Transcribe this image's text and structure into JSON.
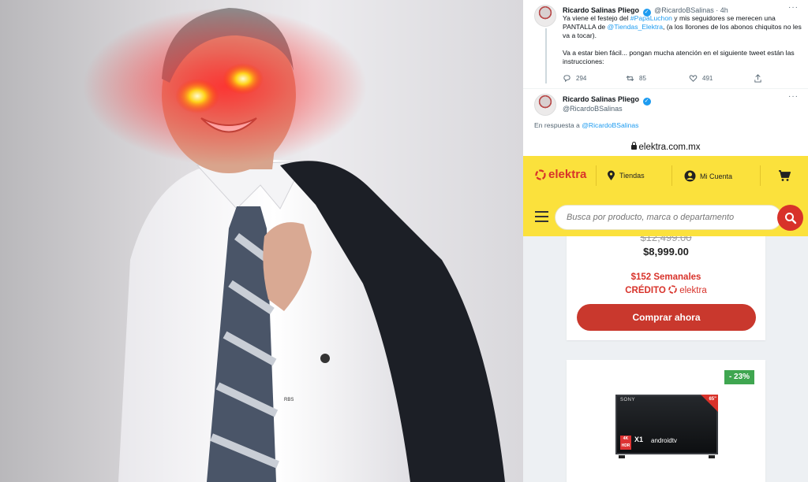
{
  "tweet1": {
    "name": "Ricardo Salinas Pliego",
    "handle": "@RicardoBSalinas",
    "time": "· 4h",
    "text_p1_a": "Ya viene el festejo del ",
    "hashtag": "#PapaLuchon",
    "text_p1_b": " y mis seguidores se merecen una PANTALLA de ",
    "mention": "@Tiendas_Elektra",
    "text_p1_c": ", (a los llorones de los abonos chiquitos no les va a tocar).",
    "text_p2": "Va a estar bien fácil... pongan mucha atención en el siguiente tweet están las instrucciones:",
    "replies": "294",
    "retweets": "85",
    "likes": "491"
  },
  "tweet2": {
    "name": "Ricardo Salinas Pliego",
    "handle": "@RicardoBSalinas",
    "reply_prefix": "En respuesta a ",
    "reply_to": "@RicardoBSalinas"
  },
  "browser": {
    "url": "elektra.com.mx"
  },
  "elektra": {
    "logo": "elektra",
    "nav_stores": "Tiendas",
    "nav_account": "Mi Cuenta",
    "search_placeholder": "Busca por producto, marca o departamento",
    "product1": {
      "old_price": "$12,499.00",
      "price": "$8,999.00",
      "weekly": "$152 Semanales",
      "credit_label": "CRÉDITO",
      "credit_brand": "elektra",
      "buy_label": "Comprar ahora"
    },
    "product2": {
      "discount": "- 23%",
      "tv_brand": "SONY",
      "tv_model": "X1",
      "tv_os": "androidtv",
      "tv_size": "65\"",
      "tv_badge": "4K HDR"
    }
  },
  "colors": {
    "elektra_yellow": "#fbe13c",
    "elektra_red": "#d8322a",
    "twitter_blue": "#1d9bf0",
    "discount_green": "#3fa650"
  }
}
